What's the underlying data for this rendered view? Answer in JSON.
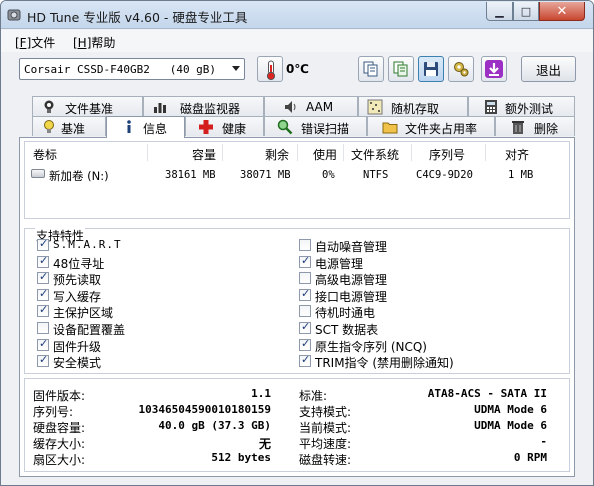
{
  "window": {
    "title": "HD Tune 专业版 v4.60 - 硬盘专业工具"
  },
  "menu": [
    {
      "key": "[F]",
      "label": "文件"
    },
    {
      "key": "[H]",
      "label": "帮助"
    }
  ],
  "toolbar": {
    "drive": "Corsair CSSD-F40GB2   (40 gB)",
    "temperature": "0℃",
    "exit_label": "退出",
    "buttons": [
      "copy-icon",
      "copy-list-icon",
      "save-icon",
      "settings-icon",
      "download-icon"
    ]
  },
  "tabs_top": [
    {
      "label": "文件基准",
      "icon": "lightbulb-icon"
    },
    {
      "label": "磁盘监视器",
      "icon": "chart-icon"
    },
    {
      "label": "AAM",
      "icon": "speaker-icon"
    },
    {
      "label": "随机存取",
      "icon": "dots-icon"
    },
    {
      "label": "额外测试",
      "icon": "calculator-icon"
    }
  ],
  "tabs_bottom": [
    {
      "label": "基准",
      "icon": "bulb-icon"
    },
    {
      "label": "信息",
      "icon": "info-icon",
      "active": true
    },
    {
      "label": "健康",
      "icon": "plus-icon"
    },
    {
      "label": "错误扫描",
      "icon": "magnifier-icon"
    },
    {
      "label": "文件夹占用率",
      "icon": "folder-icon"
    },
    {
      "label": "删除",
      "icon": "trash-icon"
    }
  ],
  "volumes": {
    "headers": [
      "卷标",
      "容量",
      "剩余",
      "使用",
      "文件系统",
      "序列号",
      "对齐"
    ],
    "rows": [
      {
        "label": "新加卷 (N:)",
        "capacity": "38161 MB",
        "free": "38071 MB",
        "used": "0%",
        "fs": "NTFS",
        "serial": "C4C9-9D20",
        "align": "1 MB"
      }
    ]
  },
  "features": {
    "title": "支持特性",
    "left": [
      {
        "label": "S.M.A.R.T",
        "checked": true
      },
      {
        "label": "48位寻址",
        "checked": true
      },
      {
        "label": "预先读取",
        "checked": true
      },
      {
        "label": "写入缓存",
        "checked": true
      },
      {
        "label": "主保护区域",
        "checked": true
      },
      {
        "label": "设备配置覆盖",
        "checked": false
      },
      {
        "label": "固件升级",
        "checked": true
      },
      {
        "label": "安全模式",
        "checked": true
      }
    ],
    "right": [
      {
        "label": "自动噪音管理",
        "checked": false
      },
      {
        "label": "电源管理",
        "checked": true
      },
      {
        "label": "高级电源管理",
        "checked": false
      },
      {
        "label": "接口电源管理",
        "checked": true
      },
      {
        "label": "待机时通电",
        "checked": false
      },
      {
        "label": "SCT 数据表",
        "checked": true
      },
      {
        "label": "原生指令序列 (NCQ)",
        "checked": true
      },
      {
        "label": "TRIM指令 (禁用删除通知)",
        "checked": true
      }
    ]
  },
  "specs": {
    "left": [
      {
        "key": "固件版本:",
        "value": "1.1"
      },
      {
        "key": "序列号:",
        "value": "10346504590010180159"
      },
      {
        "key": "硬盘容量:",
        "value": "40.0 gB (37.3 GB)"
      },
      {
        "key": "缓存大小:",
        "value": "无"
      },
      {
        "key": "扇区大小:",
        "value": "512 bytes"
      }
    ],
    "right": [
      {
        "key": "标准:",
        "value": "ATA8-ACS - SATA II"
      },
      {
        "key": "支持模式:",
        "value": "UDMA Mode 6"
      },
      {
        "key": "当前模式:",
        "value": "UDMA Mode 6"
      },
      {
        "key": "平均速度:",
        "value": "-"
      },
      {
        "key": "磁盘转速:",
        "value": "0 RPM"
      }
    ]
  }
}
